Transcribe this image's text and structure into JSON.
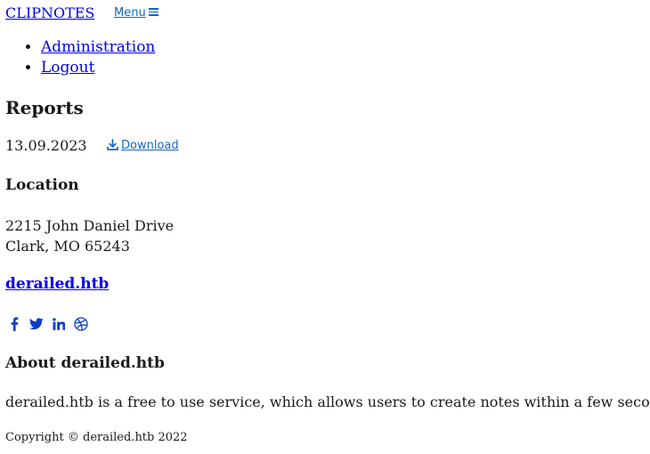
{
  "header": {
    "brand": "CLIPNOTES",
    "menu_label": "Menu"
  },
  "nav": {
    "items": [
      {
        "label": "Administration"
      },
      {
        "label": "Logout"
      }
    ]
  },
  "reports": {
    "title": "Reports",
    "date": "13.09.2023",
    "download_label": "Download"
  },
  "location": {
    "title": "Location",
    "line1": "2215 John Daniel Drive",
    "line2": "Clark, MO 65243"
  },
  "site_link": "derailed.htb",
  "social": {
    "icons": [
      "facebook-icon",
      "twitter-icon",
      "linkedin-icon",
      "dribbble-icon"
    ],
    "color": "#0d3fc9"
  },
  "about": {
    "title": "About derailed.htb",
    "text": "derailed.htb is a free to use service, which allows users to create notes within a few seconds."
  },
  "footer": {
    "copyright": "Copyright © derailed.htb 2022"
  }
}
